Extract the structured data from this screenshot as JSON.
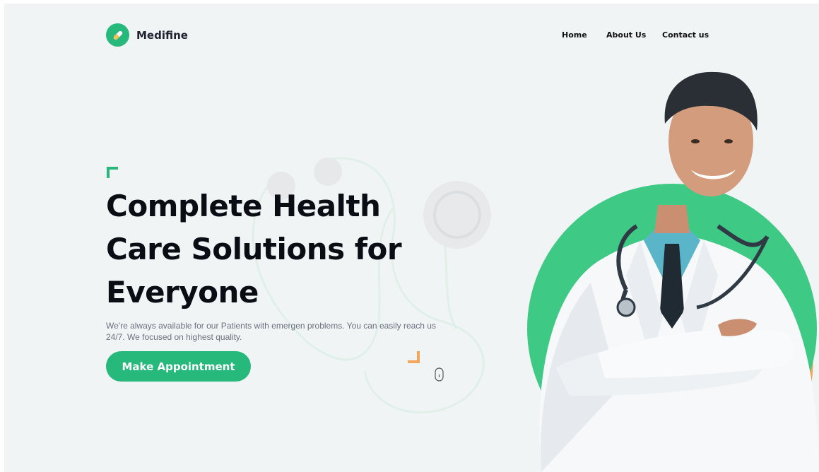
{
  "brand": {
    "name": "Medifine",
    "logo_icon": "pill-icon",
    "accent_color": "#27b97c"
  },
  "nav": {
    "items": [
      {
        "label": "Home"
      },
      {
        "label": "About Us"
      },
      {
        "label": "Contact us"
      }
    ]
  },
  "hero": {
    "title": "Complete Health Care Solutions for Everyone",
    "description": "We're always available for our Patients with emergen problems. You can easily reach us 24/7. We focused on highest quality.",
    "cta_label": "Make Appointment",
    "decor_accent_color": "#f5a65b",
    "image": "doctor-photo"
  }
}
